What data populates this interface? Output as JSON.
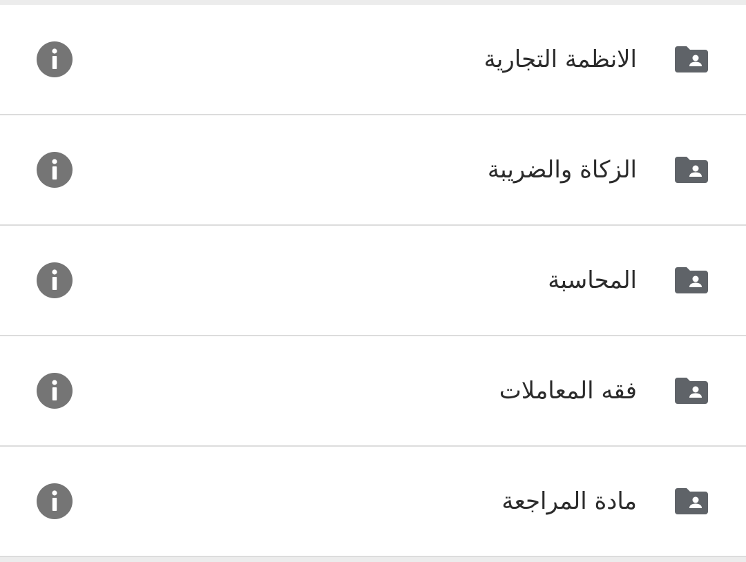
{
  "folders": [
    {
      "label": "الانظمة التجارية",
      "icon": "folder-shared-icon",
      "action_icon": "info-icon"
    },
    {
      "label": "الزكاة والضريبة",
      "icon": "folder-shared-icon",
      "action_icon": "info-icon"
    },
    {
      "label": "المحاسبة",
      "icon": "folder-shared-icon",
      "action_icon": "info-icon"
    },
    {
      "label": "فقه المعاملات",
      "icon": "folder-shared-icon",
      "action_icon": "info-icon"
    },
    {
      "label": "مادة المراجعة",
      "icon": "folder-shared-icon",
      "action_icon": "info-icon"
    }
  ],
  "colors": {
    "icon": "#5f6368",
    "info": "#757575",
    "text": "#2b2b2b",
    "divider": "#dcdcdc",
    "background": "#ececec"
  }
}
